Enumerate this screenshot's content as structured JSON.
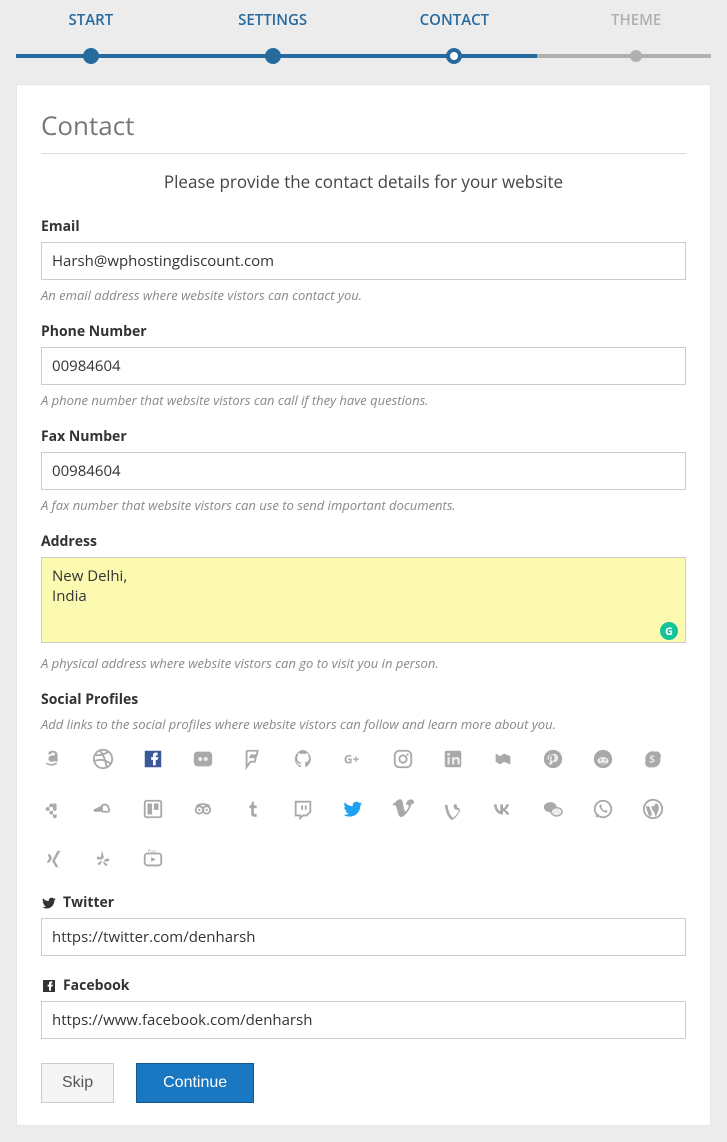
{
  "stepper": {
    "items": [
      {
        "label": "START"
      },
      {
        "label": "SETTINGS"
      },
      {
        "label": "CONTACT"
      },
      {
        "label": "THEME"
      }
    ]
  },
  "page": {
    "title": "Contact",
    "subtitle": "Please provide the contact details for your website"
  },
  "fields": {
    "email": {
      "label": "Email",
      "value": "Harsh@wphostingdiscount.com",
      "hint": "An email address where website vistors can contact you."
    },
    "phone": {
      "label": "Phone Number",
      "value": "00984604",
      "hint": "A phone number that website vistors can call if they have questions."
    },
    "fax": {
      "label": "Fax Number",
      "value": "00984604",
      "hint": "A fax number that website vistors can use to send important documents."
    },
    "address": {
      "label": "Address",
      "value": "New Delhi,\nIndia",
      "hint": "A physical address where website vistors can go to visit you in person."
    }
  },
  "social": {
    "heading": "Social Profiles",
    "hint": "Add links to the social profiles where website vistors can follow and learn more about you.",
    "twitter": {
      "label": "Twitter",
      "value": "https://twitter.com/denharsh"
    },
    "facebook": {
      "label": "Facebook",
      "value": "https://www.facebook.com/denharsh"
    }
  },
  "buttons": {
    "skip": "Skip",
    "continue": "Continue"
  }
}
